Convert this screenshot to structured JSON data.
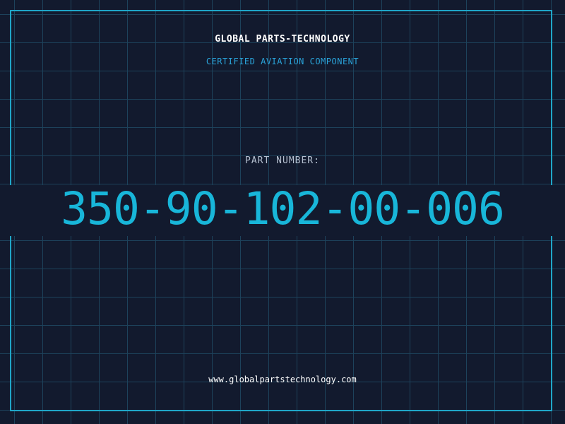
{
  "header": {
    "company": "GLOBAL PARTS-TECHNOLOGY",
    "tagline": "CERTIFIED AVIATION COMPONENT"
  },
  "part": {
    "label": "PART NUMBER:",
    "number": "350-90-102-00-006"
  },
  "footer": {
    "url": "www.globalpartstechnology.com"
  },
  "colors": {
    "background": "#121a2e",
    "grid": "#1f4a63",
    "accent": "#18b6d9",
    "frame": "#1fa6c8"
  }
}
